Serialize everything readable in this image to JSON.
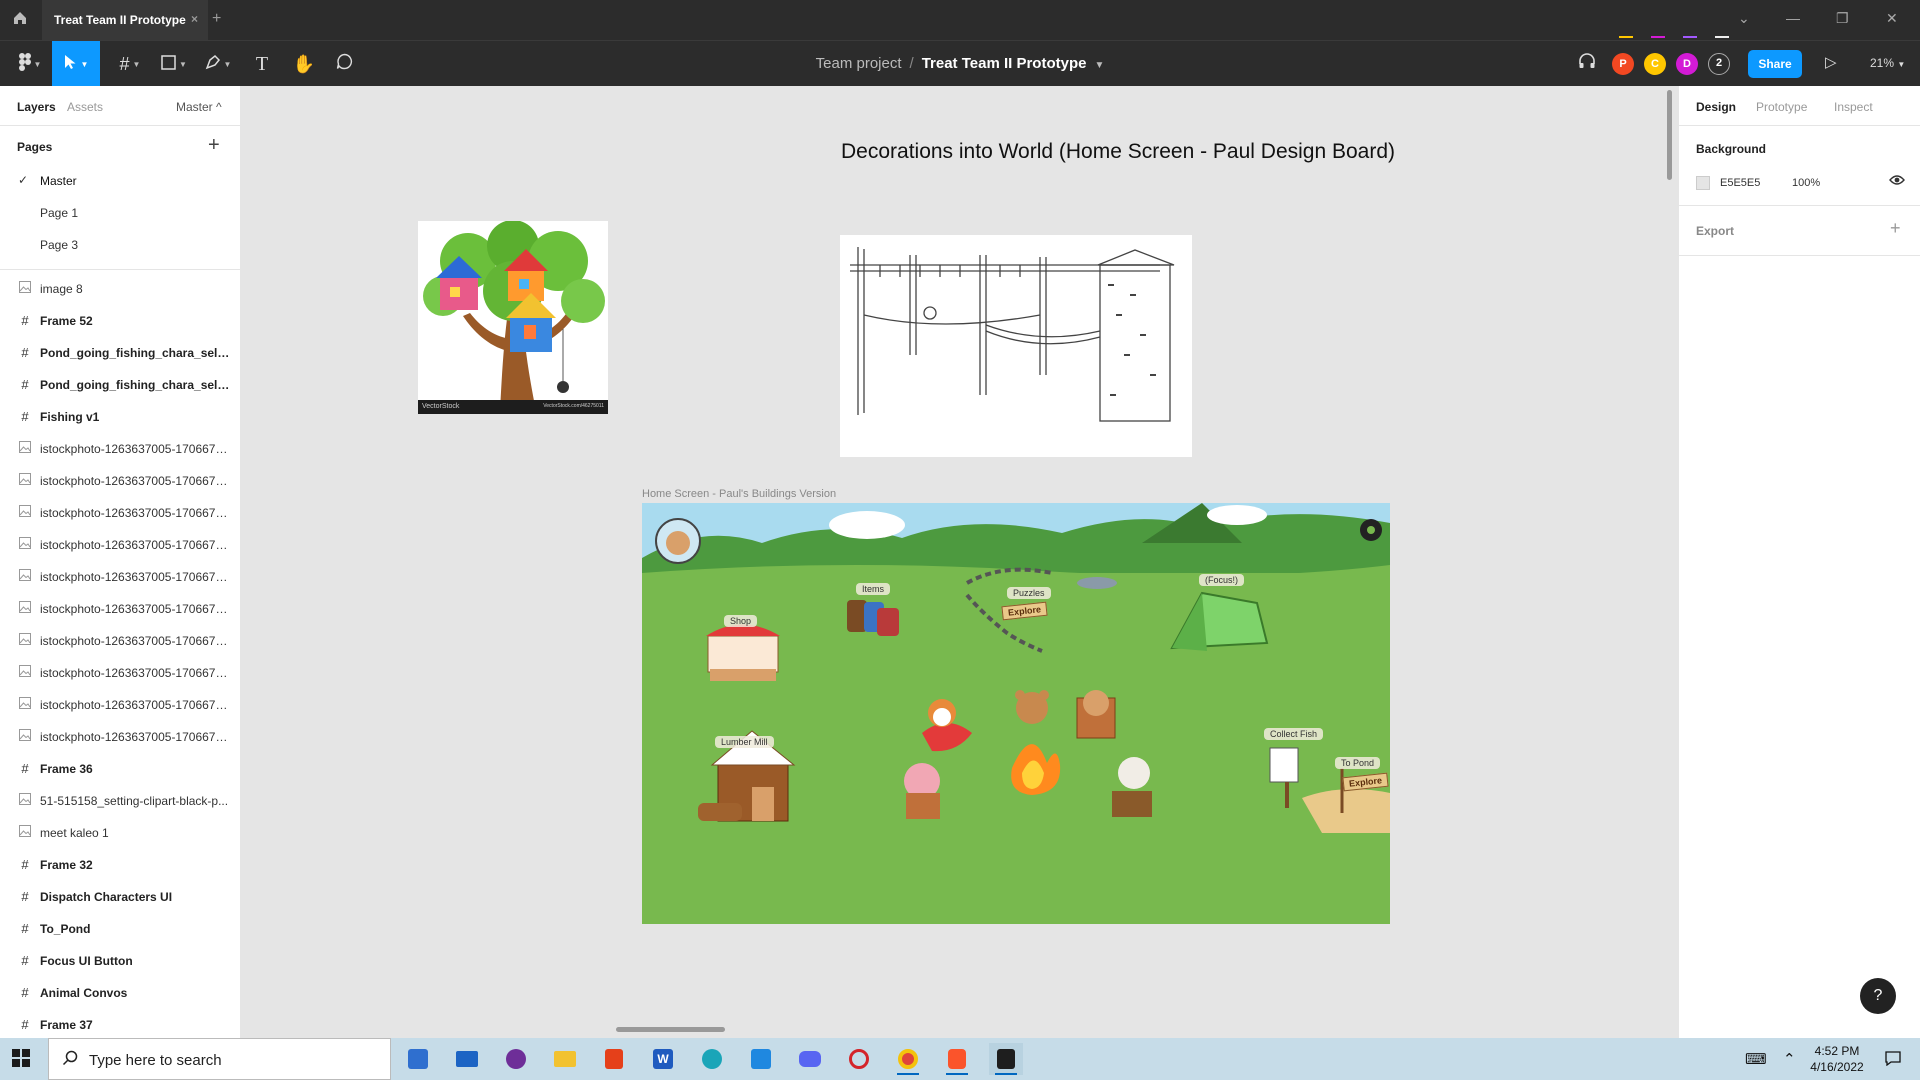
{
  "window": {
    "tab_title": "Treat Team II Prototype",
    "tab_close": "×",
    "new_tab": "+"
  },
  "toolbar": {
    "breadcrumb_team": "Team project",
    "breadcrumb_sep": "/",
    "file_name": "Treat Team II Prototype",
    "share_label": "Share",
    "zoom": "21%",
    "collaborators": [
      {
        "initial": "P",
        "color": "#f24822"
      },
      {
        "initial": "C",
        "color": "#ffc700"
      },
      {
        "initial": "D",
        "color": "#d31bd5"
      }
    ],
    "extra_count": "2"
  },
  "left_panel": {
    "tabs": {
      "layers": "Layers",
      "assets": "Assets",
      "master": "Master ^"
    },
    "pages_heading": "Pages",
    "add_page": "+",
    "pages": [
      {
        "label": "Master",
        "checked": "✓"
      },
      {
        "label": "Page 1",
        "checked": ""
      },
      {
        "label": "Page 3",
        "checked": ""
      }
    ],
    "layers": [
      {
        "type": "image",
        "name": "image 8"
      },
      {
        "type": "frame",
        "name": "Frame 52"
      },
      {
        "type": "frame",
        "name": "Pond_going_fishing_chara_selected"
      },
      {
        "type": "frame",
        "name": "Pond_going_fishing_chara_selected"
      },
      {
        "type": "frame",
        "name": "Fishing v1"
      },
      {
        "type": "image",
        "name": "istockphoto-1263637005-170667a..."
      },
      {
        "type": "image",
        "name": "istockphoto-1263637005-170667a..."
      },
      {
        "type": "image",
        "name": "istockphoto-1263637005-170667a..."
      },
      {
        "type": "image",
        "name": "istockphoto-1263637005-170667a..."
      },
      {
        "type": "image",
        "name": "istockphoto-1263637005-170667a..."
      },
      {
        "type": "image",
        "name": "istockphoto-1263637005-170667a..."
      },
      {
        "type": "image",
        "name": "istockphoto-1263637005-170667a..."
      },
      {
        "type": "image",
        "name": "istockphoto-1263637005-170667a..."
      },
      {
        "type": "image",
        "name": "istockphoto-1263637005-170667a..."
      },
      {
        "type": "image",
        "name": "istockphoto-1263637005-170667a..."
      },
      {
        "type": "frame",
        "name": "Frame 36"
      },
      {
        "type": "image",
        "name": "51-515158_setting-clipart-black-p..."
      },
      {
        "type": "image",
        "name": "meet kaleo 1"
      },
      {
        "type": "frame",
        "name": "Frame 32"
      },
      {
        "type": "frame",
        "name": "Dispatch Characters UI"
      },
      {
        "type": "frame",
        "name": "To_Pond"
      },
      {
        "type": "frame",
        "name": "Focus UI Button"
      },
      {
        "type": "frame",
        "name": "Animal Convos"
      },
      {
        "type": "frame",
        "name": "Frame 37"
      }
    ]
  },
  "canvas": {
    "title": "Decorations into World (Home Screen - Paul Design Board)",
    "treehouse_watermark": "VectorStock",
    "treehouse_watermark_url": "VectorStock.com/46275011",
    "frame_label": "Home Screen - Paul's Buildings Version",
    "game_labels": {
      "shop": "Shop",
      "items": "Items",
      "puzzles": "Puzzles",
      "explore": "Explore",
      "focus": "(Focus!)",
      "lumber_mill": "Lumber Mill",
      "collect_fish": "Collect Fish",
      "to_pond": "To Pond"
    }
  },
  "right_panel": {
    "tabs": {
      "design": "Design",
      "prototype": "Prototype",
      "inspect": "Inspect"
    },
    "background_heading": "Background",
    "background_hex": "E5E5E5",
    "background_opacity": "100%",
    "export_heading": "Export",
    "export_add": "+"
  },
  "help_label": "?",
  "taskbar": {
    "search_placeholder": "Type here to search",
    "time": "4:52 PM",
    "date": "4/16/2022"
  }
}
